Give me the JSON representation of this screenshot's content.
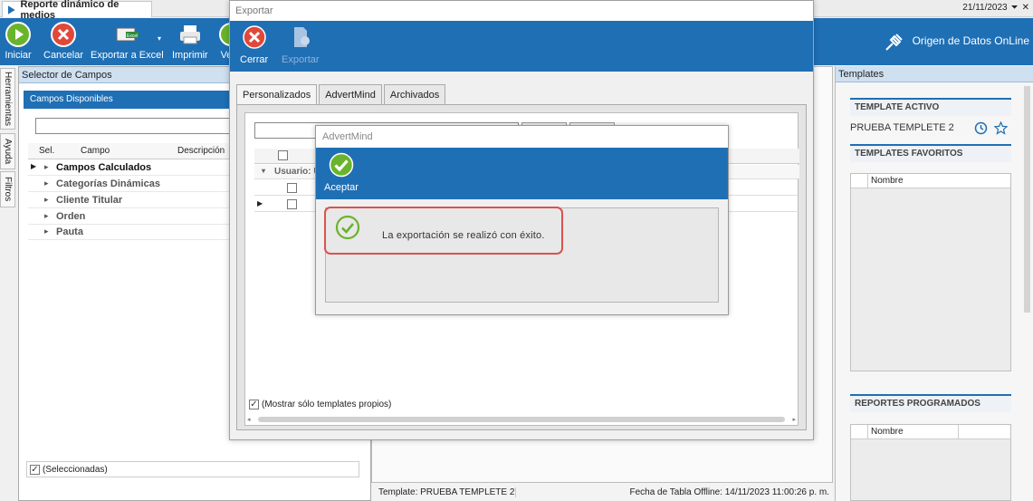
{
  "app": {
    "tab_title": "Reporte dinámico de medios",
    "date": "21/11/2023"
  },
  "ribbon": {
    "iniciar": "Iniciar",
    "cancelar": "Cancelar",
    "exportar_excel": "Exportar a Excel",
    "imprimir": "Imprimir",
    "ver_partial": "Ve",
    "origen": "Origen de Datos OnLine"
  },
  "side_tabs": [
    "Herramientas",
    "Ayuda",
    "Filtros"
  ],
  "selector": {
    "title": "Selector de Campos",
    "campos_disponibles": "Campos Disponibles",
    "col_sel": "Sel.",
    "col_campo": "Campo",
    "col_desc": "Descripción",
    "rows": [
      "Campos Calculados",
      "Categorías Dinámicas",
      "Cliente Titular",
      "Orden",
      "Pauta"
    ],
    "footer": "(Seleccionadas)"
  },
  "status": {
    "template": "Template: PRUEBA TEMPLETE 2",
    "fecha": "Fecha de Tabla Offline: 14/11/2023 11:00:26 p. m."
  },
  "templates": {
    "title": "Templates",
    "activo_hdr": "TEMPLATE ACTIVO",
    "activo_value": "PRUEBA TEMPLETE 2",
    "favoritos_hdr": "TEMPLATES FAVORITOS",
    "programados_hdr": "REPORTES PROGRAMADOS",
    "col_nombre": "Nombre"
  },
  "export_dialog": {
    "title": "Exportar",
    "cerrar": "Cerrar",
    "exportar": "Exportar",
    "tabs": [
      "Personalizados",
      "AdvertMind",
      "Archivados"
    ],
    "group_label": "Usuario: U",
    "footer": "(Mostrar sólo templates propios)"
  },
  "message": {
    "title": "AdvertMind",
    "aceptar": "Aceptar",
    "text": "La exportación se realizó con éxito."
  },
  "colors": {
    "accent": "#1f6fb5",
    "success": "#6ab42d",
    "danger": "#e0483a",
    "highlight": "#d9534f"
  }
}
